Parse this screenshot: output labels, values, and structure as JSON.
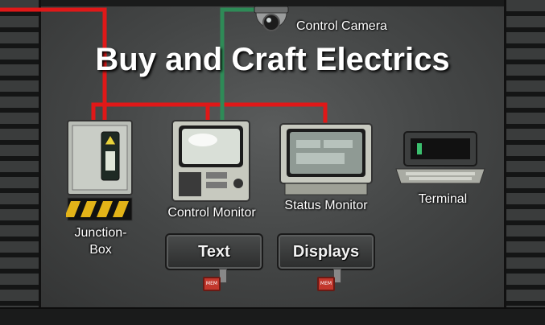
{
  "title": "Buy and Craft Electrics",
  "camera": {
    "label": "Control Camera",
    "icon": "camera-icon"
  },
  "items": {
    "junction_box": {
      "label_line1": "Junction-",
      "label_line2": "Box",
      "icon": "junction-box-icon"
    },
    "control_monitor": {
      "label": "Control Monitor",
      "icon": "monitor-icon"
    },
    "status_monitor": {
      "label": "Status Monitor",
      "icon": "monitor-icon"
    },
    "terminal": {
      "label": "Terminal",
      "icon": "terminal-icon"
    }
  },
  "buttons": {
    "text": {
      "label": "Text",
      "mem": "MEM"
    },
    "displays": {
      "label": "Displays",
      "mem": "MEM"
    }
  },
  "colors": {
    "wire_red": "#e01818",
    "wire_green": "#2e8b57",
    "background": "#4a4c4c"
  }
}
